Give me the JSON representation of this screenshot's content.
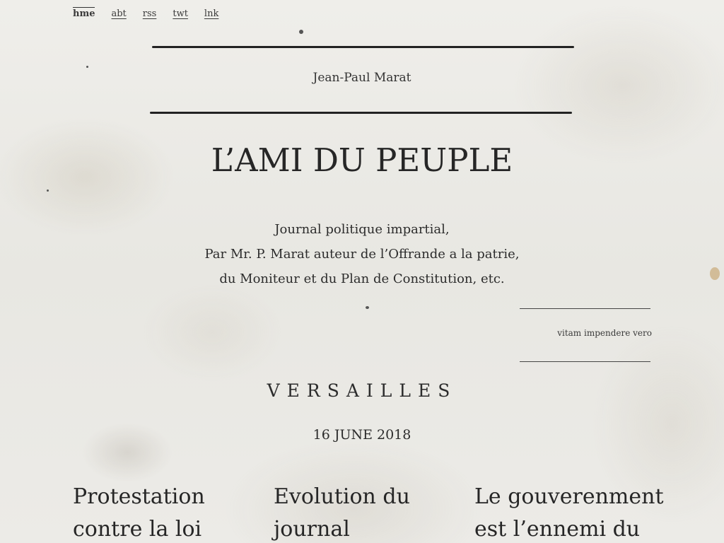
{
  "nav": {
    "items": [
      {
        "label": "hme",
        "active": true
      },
      {
        "label": "abt",
        "active": false
      },
      {
        "label": "rss",
        "active": false
      },
      {
        "label": "twt",
        "active": false
      },
      {
        "label": "lnk",
        "active": false
      }
    ]
  },
  "header": {
    "author": "Jean-Paul Marat",
    "title": "L’AMI DU PEUPLE",
    "subtitle_lines": [
      "Journal politique impartial,",
      "Par Mr. P. Marat auteur de l’Offrande a la patrie,",
      "du Moniteur et du Plan de Constitution, etc."
    ],
    "motto": "vitam impendere vero"
  },
  "edition": {
    "place": "VERSAILLES",
    "date": "16 JUNE 2018"
  },
  "articles": [
    {
      "title": "Protestation contre la loi"
    },
    {
      "title": "Evolution du journal"
    },
    {
      "title": "Le gouverenment est l’ennemi du"
    }
  ],
  "colors": {
    "paper": "#ebeae6",
    "ink": "#262626"
  }
}
